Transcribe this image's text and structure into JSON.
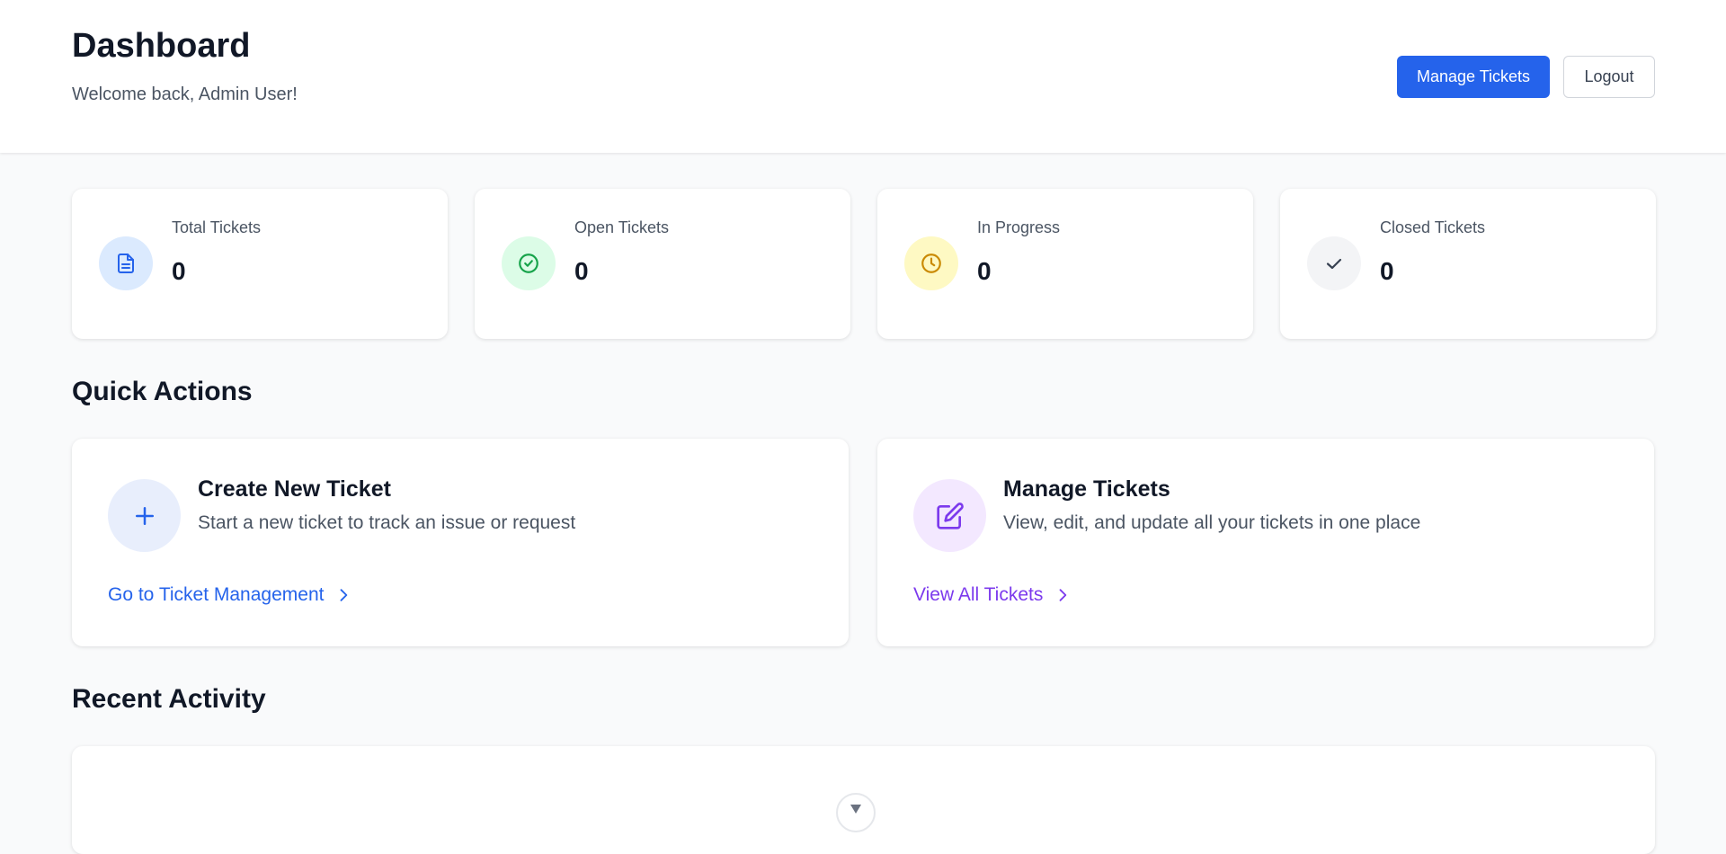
{
  "header": {
    "title": "Dashboard",
    "subtitle": "Welcome back, Admin User!",
    "manage_tickets_label": "Manage Tickets",
    "logout_label": "Logout"
  },
  "stats": [
    {
      "label": "Total Tickets",
      "value": "0",
      "icon": "document-icon",
      "icon_bg": "#dbeafe",
      "icon_color": "#2563eb"
    },
    {
      "label": "Open Tickets",
      "value": "0",
      "icon": "check-circle-icon",
      "icon_bg": "#dcfce7",
      "icon_color": "#16a34a"
    },
    {
      "label": "In Progress",
      "value": "0",
      "icon": "clock-icon",
      "icon_bg": "#fef9c3",
      "icon_color": "#ca8a04"
    },
    {
      "label": "Closed Tickets",
      "value": "0",
      "icon": "check-icon",
      "icon_bg": "#f3f4f6",
      "icon_color": "#374151"
    }
  ],
  "quick_actions": {
    "title": "Quick Actions",
    "cards": [
      {
        "title": "Create New Ticket",
        "description": "Start a new ticket to track an issue or request",
        "link_label": "Go to Ticket Management",
        "icon": "plus-icon",
        "icon_bg": "#e0e7ff",
        "accent": "#2563eb"
      },
      {
        "title": "Manage Tickets",
        "description": "View, edit, and update all your tickets in one place",
        "link_label": "View All Tickets",
        "icon": "edit-icon",
        "icon_bg": "#f3e8ff",
        "accent": "#7c3aed"
      }
    ]
  },
  "recent_activity": {
    "title": "Recent Activity"
  }
}
